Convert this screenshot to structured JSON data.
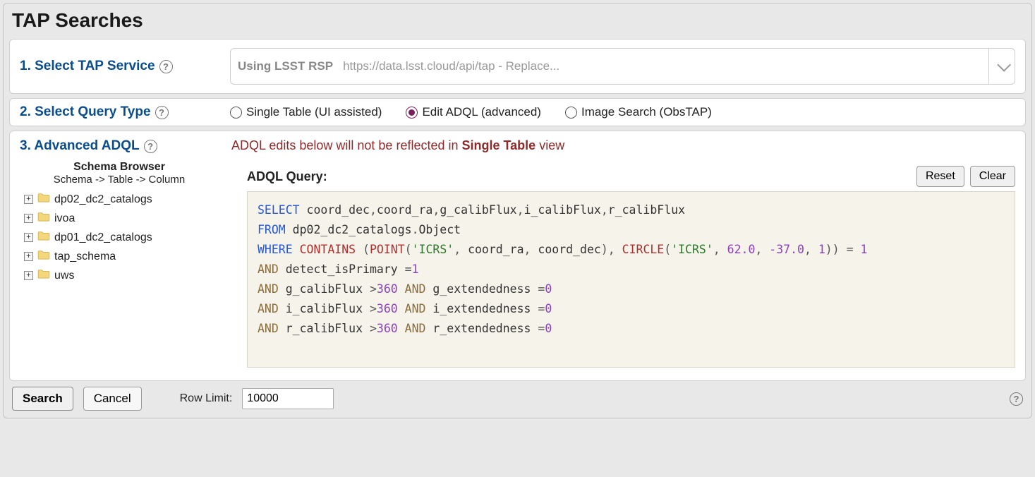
{
  "title": "TAP Searches",
  "step1": {
    "label": "1. Select TAP Service",
    "service_name": "Using LSST RSP",
    "service_url": "https://data.lsst.cloud/api/tap - Replace..."
  },
  "step2": {
    "label": "2. Select Query Type",
    "options": {
      "single": "Single Table (UI assisted)",
      "adql": "Edit ADQL (advanced)",
      "image": "Image Search (ObsTAP)"
    },
    "selected": "adql"
  },
  "step3": {
    "label": "3. Advanced ADQL",
    "warning_prefix": "ADQL edits below will not be reflected in ",
    "warning_bold": "Single Table",
    "warning_suffix": " view",
    "schema_title": "Schema Browser",
    "schema_path": "Schema -> Table -> Column",
    "schemas": [
      {
        "name": "dp02_dc2_catalogs"
      },
      {
        "name": "ivoa"
      },
      {
        "name": "dp01_dc2_catalogs"
      },
      {
        "name": "tap_schema"
      },
      {
        "name": "uws"
      }
    ],
    "query_label": "ADQL Query:",
    "reset_label": "Reset",
    "clear_label": "Clear",
    "query_tokens": [
      [
        {
          "c": "kw-blue",
          "t": "SELECT"
        },
        {
          "c": "ident",
          "t": " coord_dec"
        },
        {
          "c": "punct",
          "t": ","
        },
        {
          "c": "ident",
          "t": "coord_ra"
        },
        {
          "c": "punct",
          "t": ","
        },
        {
          "c": "ident",
          "t": "g_calibFlux"
        },
        {
          "c": "punct",
          "t": ","
        },
        {
          "c": "ident",
          "t": "i_calibFlux"
        },
        {
          "c": "punct",
          "t": ","
        },
        {
          "c": "ident",
          "t": "r_calibFlux"
        }
      ],
      [
        {
          "c": "kw-blue",
          "t": "FROM"
        },
        {
          "c": "ident",
          "t": " dp02_dc2_catalogs"
        },
        {
          "c": "punct",
          "t": "."
        },
        {
          "c": "ident",
          "t": "Object"
        }
      ],
      [
        {
          "c": "kw-blue",
          "t": "WHERE"
        },
        {
          "c": "ident",
          "t": " "
        },
        {
          "c": "fn",
          "t": "CONTAINS"
        },
        {
          "c": "ident",
          "t": " "
        },
        {
          "c": "punct",
          "t": "("
        },
        {
          "c": "fn",
          "t": "POINT"
        },
        {
          "c": "punct",
          "t": "("
        },
        {
          "c": "str",
          "t": "'ICRS'"
        },
        {
          "c": "punct",
          "t": ", "
        },
        {
          "c": "ident",
          "t": "coord_ra"
        },
        {
          "c": "punct",
          "t": ", "
        },
        {
          "c": "ident",
          "t": "coord_dec"
        },
        {
          "c": "punct",
          "t": "), "
        },
        {
          "c": "fn",
          "t": "CIRCLE"
        },
        {
          "c": "punct",
          "t": "("
        },
        {
          "c": "str",
          "t": "'ICRS'"
        },
        {
          "c": "punct",
          "t": ", "
        },
        {
          "c": "num",
          "t": "62.0"
        },
        {
          "c": "punct",
          "t": ", "
        },
        {
          "c": "num",
          "t": "-37.0"
        },
        {
          "c": "punct",
          "t": ", "
        },
        {
          "c": "num",
          "t": "1"
        },
        {
          "c": "punct",
          "t": ")) "
        },
        {
          "c": "punct",
          "t": "= "
        },
        {
          "c": "num",
          "t": "1"
        }
      ],
      [
        {
          "c": "kw-brown",
          "t": "AND"
        },
        {
          "c": "ident",
          "t": " detect_isPrimary "
        },
        {
          "c": "punct",
          "t": "="
        },
        {
          "c": "num",
          "t": "1"
        }
      ],
      [
        {
          "c": "kw-brown",
          "t": "AND"
        },
        {
          "c": "ident",
          "t": " g_calibFlux "
        },
        {
          "c": "punct",
          "t": ">"
        },
        {
          "c": "num",
          "t": "360"
        },
        {
          "c": "ident",
          "t": " "
        },
        {
          "c": "kw-brown",
          "t": "AND"
        },
        {
          "c": "ident",
          "t": " g_extendedness "
        },
        {
          "c": "punct",
          "t": "="
        },
        {
          "c": "num",
          "t": "0"
        }
      ],
      [
        {
          "c": "kw-brown",
          "t": "AND"
        },
        {
          "c": "ident",
          "t": " i_calibFlux "
        },
        {
          "c": "punct",
          "t": ">"
        },
        {
          "c": "num",
          "t": "360"
        },
        {
          "c": "ident",
          "t": " "
        },
        {
          "c": "kw-brown",
          "t": "AND"
        },
        {
          "c": "ident",
          "t": " i_extendedness "
        },
        {
          "c": "punct",
          "t": "="
        },
        {
          "c": "num",
          "t": "0"
        }
      ],
      [
        {
          "c": "kw-brown",
          "t": "AND"
        },
        {
          "c": "ident",
          "t": " r_calibFlux "
        },
        {
          "c": "punct",
          "t": ">"
        },
        {
          "c": "num",
          "t": "360"
        },
        {
          "c": "ident",
          "t": " "
        },
        {
          "c": "kw-brown",
          "t": "AND"
        },
        {
          "c": "ident",
          "t": " r_extendedness "
        },
        {
          "c": "punct",
          "t": "="
        },
        {
          "c": "num",
          "t": "0"
        }
      ]
    ]
  },
  "bottom": {
    "search_label": "Search",
    "cancel_label": "Cancel",
    "rowlimit_label": "Row Limit:",
    "rowlimit_value": "10000"
  }
}
